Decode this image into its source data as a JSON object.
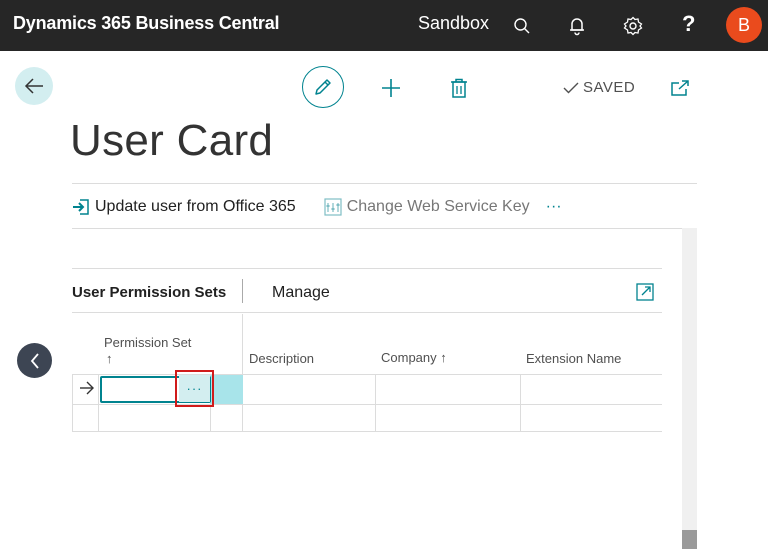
{
  "topbar": {
    "app_title": "Dynamics 365 Business Central",
    "environment": "Sandbox",
    "help_label": "?",
    "avatar_initial": "B"
  },
  "actions": {
    "saved_label": "SAVED"
  },
  "page": {
    "title": "User Card"
  },
  "action_bar": {
    "update_label": "Update user from Office 365",
    "change_label": "Change Web Service Key",
    "more_label": "···"
  },
  "part": {
    "title": "User Permission Sets",
    "manage_label": "Manage"
  },
  "table": {
    "columns": {
      "permission_set": "Permission Set",
      "permission_set_sort": "↑",
      "description": "Description",
      "company": "Company ↑",
      "extension": "Extension Name"
    },
    "lookup_label": "···"
  },
  "colors": {
    "accent": "#00838f",
    "topbar": "#262626",
    "avatar": "#ea4b1d",
    "highlight": "#d01b1b"
  }
}
